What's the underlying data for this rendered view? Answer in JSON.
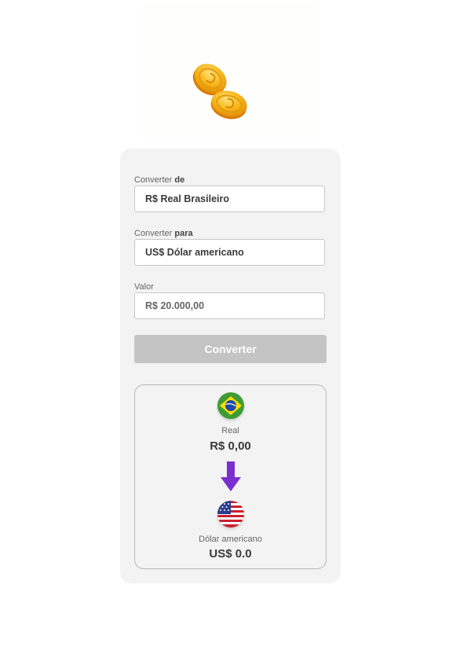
{
  "hero": {
    "icon": "coins-icon"
  },
  "form": {
    "from_label_prefix": "Converter ",
    "from_label_bold": "de",
    "from_value": "R$ Real Brasileiro",
    "to_label_prefix": "Converter ",
    "to_label_bold": "para",
    "to_value": "US$ Dólar americano",
    "amount_label": "Valor",
    "amount_value": "R$ 20.000,00",
    "convert_button": "Converter"
  },
  "result": {
    "from_flag": "brazil-flag-icon",
    "from_name": "Real",
    "from_amount": "R$ 0,00",
    "arrow": "arrow-down-icon",
    "to_flag": "usa-flag-icon",
    "to_name": "Dólar americano",
    "to_amount": "US$ 0.0"
  },
  "colors": {
    "card_bg": "#f3f3f3",
    "button_disabled": "#c4c4c4",
    "arrow": "#7a2fd1",
    "coin": "#f5b21a"
  }
}
